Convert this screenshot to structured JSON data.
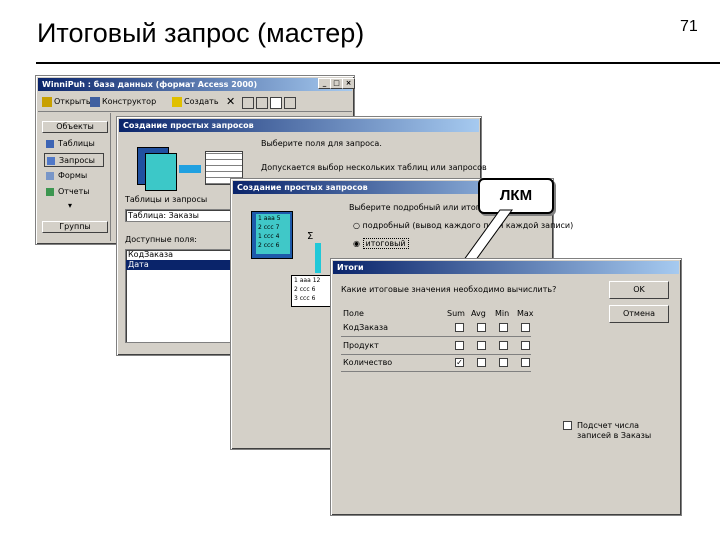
{
  "slide": {
    "title": "Итоговый запрос (мастер)",
    "page_number": "71"
  },
  "db_window": {
    "title": "WinniPuh : база данных (формат Access 2000)",
    "toolbar": {
      "open": "Открыть",
      "constructor": "Конструктор",
      "create": "Создать"
    },
    "objects_button": "Объекты",
    "items": [
      "Таблицы",
      "Запросы",
      "Формы",
      "Отчеты"
    ],
    "groups_button": "Группы"
  },
  "wizard1": {
    "title": "Создание простых запросов",
    "prompt_fields": "Выберите поля для запроса.",
    "prompt_tables": "Допускается выбор нескольких таблиц или запросов",
    "tables_label": "Таблицы и запросы",
    "tables_value": "Таблица: Заказы",
    "fields_label": "Доступные поля:",
    "fields": [
      "КодЗаказа",
      "Дата"
    ],
    "selected_field": 1
  },
  "wizard2": {
    "title": "Создание простых запросов",
    "prompt": "Выберите подробный или итоговый отчет",
    "option_detail": "подробный (вывод каждого поля каждой записи)",
    "option_total": "итоговый",
    "mini_grid_a": [
      [
        "1",
        "aaa",
        "5"
      ],
      [
        "2",
        "ccc",
        "7"
      ],
      [
        "1",
        "ccc",
        "4"
      ],
      [
        "2",
        "ccc",
        "6"
      ]
    ],
    "mini_grid_b": [
      [
        "1",
        "aaa",
        "12"
      ],
      [
        "2",
        "ccc",
        "6"
      ],
      [
        "3",
        "ccc",
        "6"
      ]
    ],
    "sum_symbol": "Σ"
  },
  "totals_dialog": {
    "title": "Итоги",
    "question": "Какие итоговые значения необходимо вычислить?",
    "ok_label": "OK",
    "cancel_label": "Отмена",
    "columns": [
      "Поле",
      "Sum",
      "Avg",
      "Min",
      "Max"
    ],
    "rows": [
      {
        "field": "КодЗаказа",
        "checks": [
          false,
          false,
          false,
          false
        ]
      },
      {
        "field": "Продукт",
        "checks": [
          false,
          false,
          false,
          false
        ]
      },
      {
        "field": "Количество",
        "checks": [
          true,
          false,
          false,
          false
        ]
      }
    ],
    "count_label": "Подсчет числа записей в Заказы"
  },
  "callout": {
    "text": "ЛКМ"
  }
}
